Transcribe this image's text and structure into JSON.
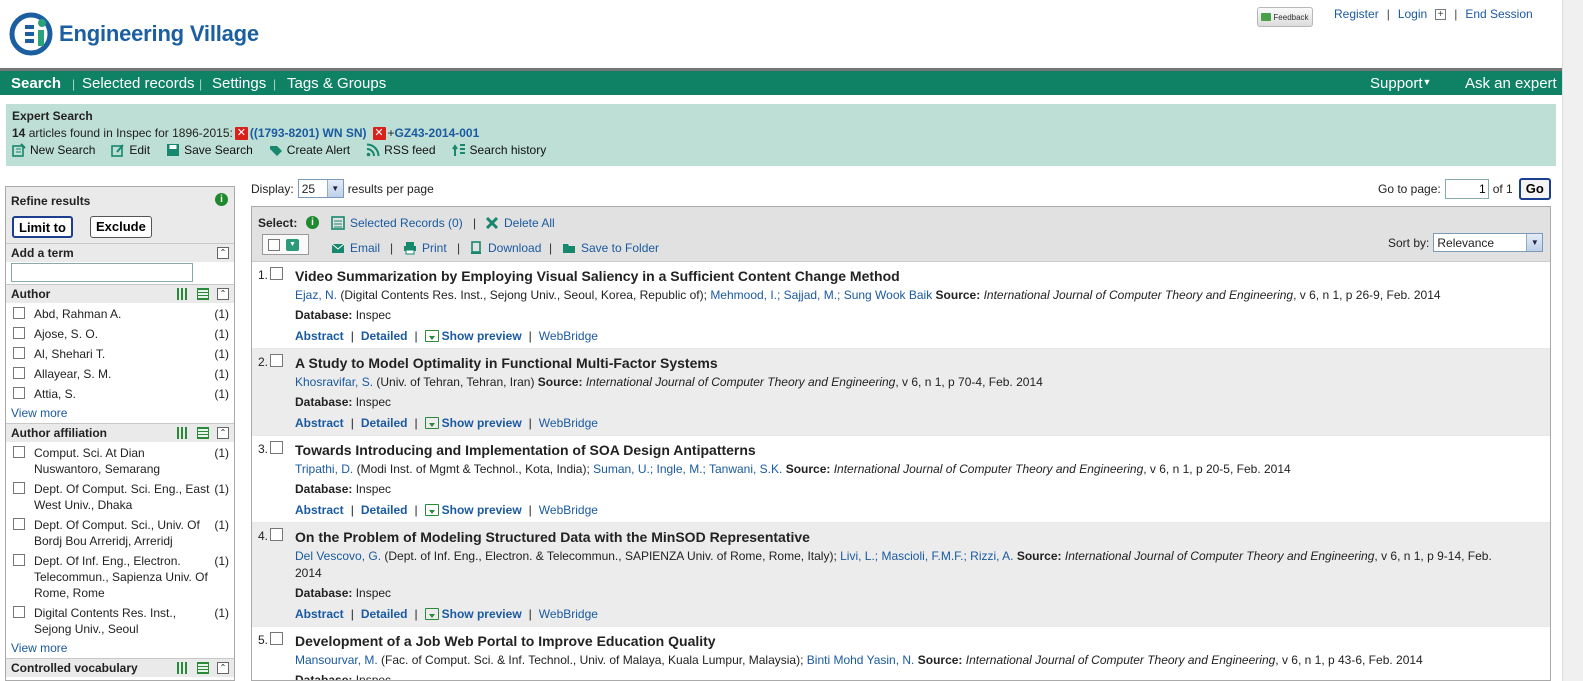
{
  "header": {
    "brand": "Engineering Village",
    "feedback_label": "Feedback",
    "links": {
      "register": "Register",
      "login": "Login",
      "end_session": "End Session"
    }
  },
  "nav": {
    "items": [
      "Search",
      "Selected records",
      "Settings",
      "Tags & Groups"
    ],
    "support": "Support",
    "ask_expert": "Ask an expert"
  },
  "search_info": {
    "title": "Expert Search",
    "count": "14",
    "found_text": " articles found in Inspec for 1896-2015:",
    "term1": "((1793-8201) WN SN)",
    "term2_prefix": "+",
    "term2": "GZ43-2014-001",
    "actions": [
      "New Search",
      "Edit",
      "Save Search",
      "Create Alert",
      "RSS feed",
      "Search history"
    ]
  },
  "refine": {
    "title": "Refine results",
    "limit_to": "Limit to",
    "exclude": "Exclude",
    "add_term": "Add a term",
    "author": {
      "title": "Author",
      "items": [
        {
          "label": "Abd, Rahman A.",
          "count": "(1)"
        },
        {
          "label": "Ajose, S. O.",
          "count": "(1)"
        },
        {
          "label": "Al, Shehari T.",
          "count": "(1)"
        },
        {
          "label": "Allayear, S. M.",
          "count": "(1)"
        },
        {
          "label": "Attia, S.",
          "count": "(1)"
        }
      ],
      "view_more": "View more"
    },
    "affiliation": {
      "title": "Author affiliation",
      "items": [
        {
          "label": "Comput. Sci. At Dian Nuswantoro, Semarang",
          "count": "(1)"
        },
        {
          "label": "Dept. Of Comput. Sci. Eng., East West Univ., Dhaka",
          "count": "(1)"
        },
        {
          "label": "Dept. Of Comput. Sci., Univ. Of Bordj Bou Arreridj, Arreridj",
          "count": "(1)"
        },
        {
          "label": "Dept. Of Inf. Eng., Electron. Telecommun., Sapienza Univ. Of Rome, Rome",
          "count": "(1)"
        },
        {
          "label": "Digital Contents Res. Inst., Sejong Univ., Seoul",
          "count": "(1)"
        }
      ],
      "view_more": "View more"
    },
    "controlled_vocab": "Controlled vocabulary"
  },
  "display": {
    "label": "Display:",
    "value": "25",
    "suffix": "results per page"
  },
  "goto": {
    "label": "Go to page:",
    "value": "1",
    "of": "of 1",
    "go": "Go"
  },
  "toolbar": {
    "select_label": "Select:",
    "selected_records": "Selected Records (0)",
    "delete_all": "Delete All",
    "email": "Email",
    "print": "Print",
    "download": "Download",
    "save_to_folder": "Save to Folder",
    "sort_label": "Sort by:",
    "sort_value": "Relevance"
  },
  "results": [
    {
      "num": "1.",
      "title": "Video Summarization by Employing Visual Saliency in a Sufficient Content Change Method",
      "first_author": "Ejaz, N.",
      "affil": " (Digital Contents Res. Inst., Sejong Univ., Seoul, Korea, Republic of); ",
      "other_authors": "Mehmood, I.; Sajjad, M.; Sung Wook Baik",
      "source_label": "Source:",
      "source": "International Journal of Computer Theory and Engineering",
      "details": ", v 6, n 1, p 26-9, Feb. 2014",
      "db_label": "Database:",
      "db": "Inspec"
    },
    {
      "num": "2.",
      "title": "A Study to Model Optimality in Functional Multi-Factor Systems",
      "first_author": "Khosravifar, S.",
      "affil": " (Univ. of Tehran, Tehran, Iran) ",
      "other_authors": "",
      "source_label": "Source:",
      "source": "International Journal of Computer Theory and Engineering",
      "details": ", v 6, n 1, p 70-4, Feb. 2014",
      "db_label": "Database:",
      "db": "Inspec"
    },
    {
      "num": "3.",
      "title": "Towards Introducing and Implementation of SOA Design Antipatterns",
      "first_author": "Tripathi, D.",
      "affil": " (Modi Inst. of Mgmt & Technol., Kota, India); ",
      "other_authors": "Suman, U.; Ingle, M.; Tanwani, S.K.",
      "source_label": "Source:",
      "source": "International Journal of Computer Theory and Engineering",
      "details": ", v 6, n 1, p 20-5, Feb. 2014",
      "db_label": "Database:",
      "db": "Inspec"
    },
    {
      "num": "4.",
      "title": "On the Problem of Modeling Structured Data with the MinSOD Representative",
      "first_author": "Del Vescovo, G.",
      "affil": " (Dept. of Inf. Eng., Electron. & Telecommun., SAPIENZA Univ. of Rome, Rome, Italy); ",
      "other_authors": "Livi, L.; Mascioli, F.M.F.; Rizzi, A.",
      "source_label": "Source:",
      "source": "International Journal of Computer Theory and Engineering",
      "details": ", v 6, n 1, p 9-14, Feb. 2014",
      "db_label": "Database:",
      "db": "Inspec"
    },
    {
      "num": "5.",
      "title": "Development of a Job Web Portal to Improve Education Quality",
      "first_author": "Mansourvar, M.",
      "affil": " (Fac. of Comput. Sci. & Inf. Technol., Univ. of Malaya, Kuala Lumpur, Malaysia); ",
      "other_authors": "Binti Mohd Yasin, N.",
      "source_label": "Source:",
      "source": "International Journal of Computer Theory and Engineering",
      "details": ", v 6, n 1, p 43-6, Feb. 2014",
      "db_label": "Database:",
      "db": "Inspec"
    }
  ],
  "result_links": {
    "abstract": "Abstract",
    "detailed": "Detailed",
    "preview": "Show preview",
    "webbridge": "WebBridge"
  },
  "colors": {
    "nav_green": "#0f8266",
    "panel_green": "#bedfd5",
    "link_blue": "#1a5aa0"
  }
}
